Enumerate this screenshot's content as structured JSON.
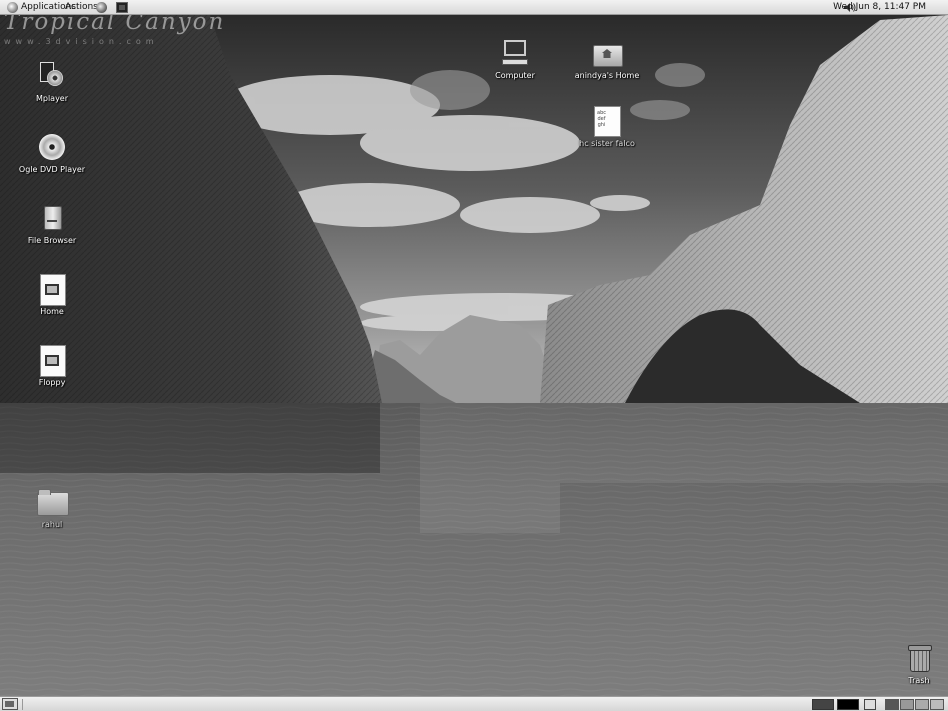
{
  "top_panel": {
    "applications_label": "Applications",
    "actions_label": "Actions",
    "clock": "Wed Jun  8, 11:47 PM",
    "launchers": [
      "web-browser-icon",
      "terminal-icon"
    ],
    "volume_icon": "speaker-icon"
  },
  "wallpaper": {
    "brand": "Tropical Canyon",
    "url": "www.3dvision.com"
  },
  "desktop_icons": {
    "mplayer": "Mplayer",
    "ogle": "Ogle DVD Player",
    "file_browser": "File Browser",
    "home": "Home",
    "floppy": "Floppy",
    "computer": "Computer",
    "anindya_home": "anindya's Home",
    "text_file": "hc sister falco",
    "rahul": "rahul",
    "trash": "Trash"
  },
  "bottom_panel": {
    "workspaces": [
      "workspace-1",
      "workspace-2",
      "workspace-3",
      "workspace-4"
    ]
  }
}
